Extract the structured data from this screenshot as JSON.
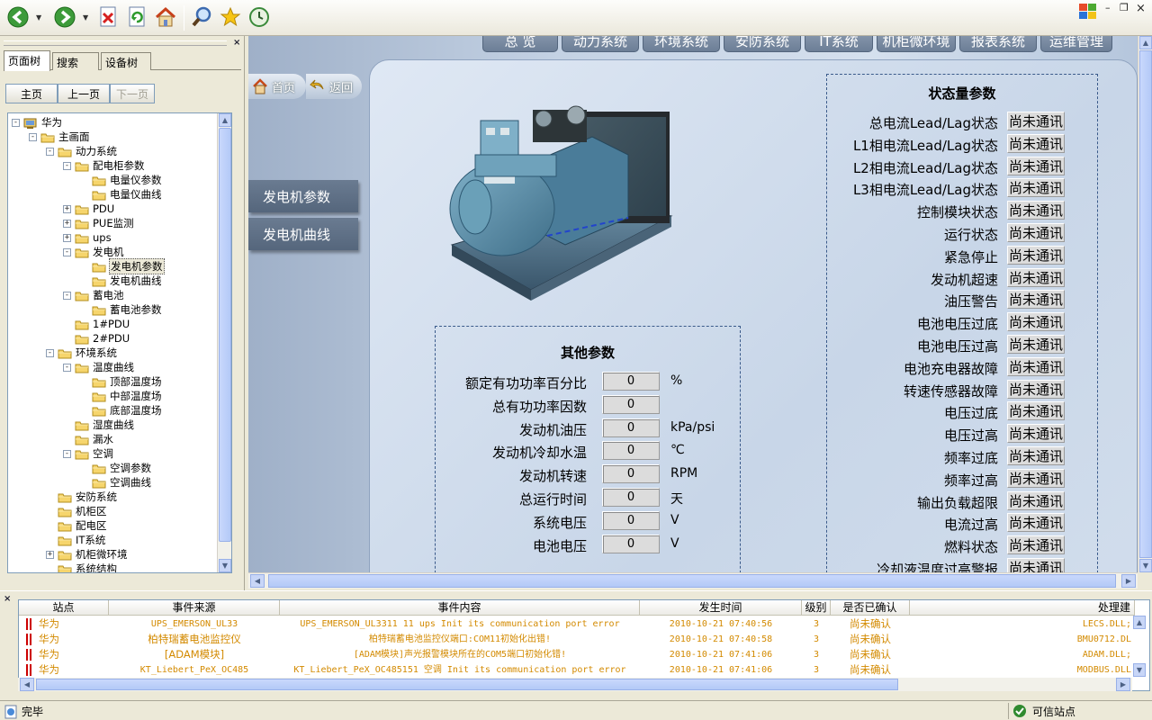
{
  "window": {
    "controls": {
      "minimize": "–",
      "restore": "❐",
      "close": "×"
    }
  },
  "toolbar": {
    "icons": [
      "back-icon",
      "forward-icon",
      "stop-icon",
      "refresh-icon",
      "home-icon",
      "search-icon",
      "favorites-icon",
      "history-icon"
    ]
  },
  "left_panel": {
    "close": "×",
    "tabs": [
      "页面树",
      "搜索",
      "设备树"
    ],
    "nav": {
      "home": "主页",
      "prev": "上一页",
      "next": "下一页"
    },
    "tree": [
      {
        "label": "华为",
        "level": 0,
        "exp": "-",
        "kind": "root"
      },
      {
        "label": "主画面",
        "level": 1,
        "exp": "-"
      },
      {
        "label": "动力系统",
        "level": 2,
        "exp": "-"
      },
      {
        "label": "配电柜参数",
        "level": 3,
        "exp": "-"
      },
      {
        "label": "电量仪参数",
        "level": 4,
        "exp": ""
      },
      {
        "label": "电量仪曲线",
        "level": 4,
        "exp": ""
      },
      {
        "label": "PDU",
        "level": 3,
        "exp": "+"
      },
      {
        "label": "PUE监测",
        "level": 3,
        "exp": "+"
      },
      {
        "label": "ups",
        "level": 3,
        "exp": "+"
      },
      {
        "label": "发电机",
        "level": 3,
        "exp": "-"
      },
      {
        "label": "发电机参数",
        "level": 4,
        "exp": "",
        "selected": true
      },
      {
        "label": "发电机曲线",
        "level": 4,
        "exp": ""
      },
      {
        "label": "蓄电池",
        "level": 3,
        "exp": "-"
      },
      {
        "label": "蓄电池参数",
        "level": 4,
        "exp": ""
      },
      {
        "label": "1#PDU",
        "level": 3,
        "exp": ""
      },
      {
        "label": "2#PDU",
        "level": 3,
        "exp": ""
      },
      {
        "label": "环境系统",
        "level": 2,
        "exp": "-"
      },
      {
        "label": "温度曲线",
        "level": 3,
        "exp": "-"
      },
      {
        "label": "顶部温度场",
        "level": 4,
        "exp": ""
      },
      {
        "label": "中部温度场",
        "level": 4,
        "exp": ""
      },
      {
        "label": "底部温度场",
        "level": 4,
        "exp": ""
      },
      {
        "label": "湿度曲线",
        "level": 3,
        "exp": ""
      },
      {
        "label": "漏水",
        "level": 3,
        "exp": ""
      },
      {
        "label": "空调",
        "level": 3,
        "exp": "-"
      },
      {
        "label": "空调参数",
        "level": 4,
        "exp": ""
      },
      {
        "label": "空调曲线",
        "level": 4,
        "exp": ""
      },
      {
        "label": "安防系统",
        "level": 2,
        "exp": ""
      },
      {
        "label": "机柜区",
        "level": 2,
        "exp": ""
      },
      {
        "label": "配电区",
        "level": 2,
        "exp": ""
      },
      {
        "label": "IT系统",
        "level": 2,
        "exp": ""
      },
      {
        "label": "机柜微环境",
        "level": 2,
        "exp": "+"
      },
      {
        "label": "系统结构",
        "level": 2,
        "exp": ""
      }
    ]
  },
  "main": {
    "menu": [
      "总 览",
      "动力系统",
      "环境系统",
      "安防系统",
      "IT系统",
      "机柜微环境",
      "报表系统",
      "运维管理"
    ],
    "home_btn": "首页",
    "back_btn": "返回",
    "side_buttons": [
      "发电机参数",
      "发电机曲线"
    ],
    "other_params": {
      "title": "其他参数",
      "rows": [
        {
          "label": "额定有功功率百分比",
          "value": "0",
          "unit": "%"
        },
        {
          "label": "总有功功率因数",
          "value": "0",
          "unit": ""
        },
        {
          "label": "发动机油压",
          "value": "0",
          "unit": "kPa/psi"
        },
        {
          "label": "发动机冷却水温",
          "value": "0",
          "unit": "℃"
        },
        {
          "label": "发动机转速",
          "value": "0",
          "unit": "RPM"
        },
        {
          "label": "总运行时间",
          "value": "0",
          "unit": "天"
        },
        {
          "label": "系统电压",
          "value": "0",
          "unit": "V"
        },
        {
          "label": "电池电压",
          "value": "0",
          "unit": "V"
        }
      ]
    },
    "status_params": {
      "title": "状态量参数",
      "rows": [
        {
          "label": "总电流Lead/Lag状态",
          "value": "尚未通讯"
        },
        {
          "label": "L1相电流Lead/Lag状态",
          "value": "尚未通讯"
        },
        {
          "label": "L2相电流Lead/Lag状态",
          "value": "尚未通讯"
        },
        {
          "label": "L3相电流Lead/Lag状态",
          "value": "尚未通讯"
        },
        {
          "label": "控制模块状态",
          "value": "尚未通讯"
        },
        {
          "label": "运行状态",
          "value": "尚未通讯"
        },
        {
          "label": "紧急停止",
          "value": "尚未通讯"
        },
        {
          "label": "发动机超速",
          "value": "尚未通讯"
        },
        {
          "label": "油压警告",
          "value": "尚未通讯"
        },
        {
          "label": "电池电压过底",
          "value": "尚未通讯"
        },
        {
          "label": "电池电压过高",
          "value": "尚未通讯"
        },
        {
          "label": "电池充电器故障",
          "value": "尚未通讯"
        },
        {
          "label": "转速传感器故障",
          "value": "尚未通讯"
        },
        {
          "label": "电压过底",
          "value": "尚未通讯"
        },
        {
          "label": "电压过高",
          "value": "尚未通讯"
        },
        {
          "label": "频率过底",
          "value": "尚未通讯"
        },
        {
          "label": "频率过高",
          "value": "尚未通讯"
        },
        {
          "label": "输出负载超限",
          "value": "尚未通讯"
        },
        {
          "label": "电流过高",
          "value": "尚未通讯"
        },
        {
          "label": "燃料状态",
          "value": "尚未通讯"
        },
        {
          "label": "冷却液温度过高警报",
          "value": "尚未通讯"
        }
      ]
    }
  },
  "events": {
    "close": "×",
    "headers": [
      "站点",
      "事件来源",
      "事件内容",
      "发生时间",
      "级别",
      "是否已确认",
      "处理建"
    ],
    "rows": [
      {
        "site": "华为",
        "source": "UPS_EMERSON_UL33",
        "content": "UPS_EMERSON_UL3311 11 ups Init its communication port error",
        "time": "2010-10-21 07:40:56",
        "level": "3",
        "confirmed": "尚未确认",
        "handler": "LECS.DLL;"
      },
      {
        "site": "华为",
        "source": "柏特瑞蓄电池监控仪",
        "content": "柏特瑞蓄电池监控仪端口:COM11初始化出错!",
        "time": "2010-10-21 07:40:58",
        "level": "3",
        "confirmed": "尚未确认",
        "handler": "BMU0712.DL"
      },
      {
        "site": "华为",
        "source": "[ADAM模块]",
        "content": "[ADAM模块]声光报警模块所在的COM5端口初始化错!",
        "time": "2010-10-21 07:41:06",
        "level": "3",
        "confirmed": "尚未确认",
        "handler": "ADAM.DLL;"
      },
      {
        "site": "华为",
        "source": "KT_Liebert_PeX_OC485",
        "content": "KT_Liebert_PeX_OC485151 空调 Init its communication port error",
        "time": "2010-10-21 07:41:06",
        "level": "3",
        "confirmed": "尚未确认",
        "handler": "MODBUS.DLL"
      }
    ]
  },
  "status_bar": {
    "left": "完毕",
    "right": "可信站点"
  }
}
